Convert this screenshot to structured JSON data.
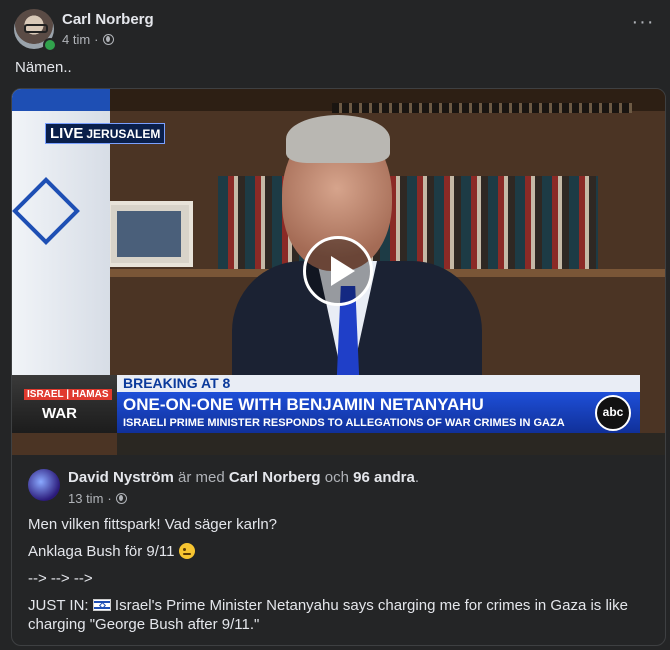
{
  "post": {
    "author": "Carl Norberg",
    "time": "4 tim",
    "separator": "·",
    "caption": "Nämen..",
    "more_icon": "more-horizontal-icon",
    "privacy_icon": "globe-icon"
  },
  "video": {
    "live_label": "LIVE",
    "live_city": "JERUSALEM",
    "chyron_sub": "ISRAEL | HAMAS",
    "chyron_war": "WAR",
    "breaking": "BREAKING AT 8",
    "headline": "ONE-ON-ONE WITH BENJAMIN NETANYAHU",
    "subheadline": "ISRAELI PRIME MINISTER RESPONDS TO ALLEGATIONS OF WAR CRIMES IN GAZA",
    "network": "abc"
  },
  "shared": {
    "author": "David Nyström",
    "with_text": "är med",
    "tagged": "Carl Norberg",
    "and_text": "och",
    "others": "96 andra",
    "period": ".",
    "time": "13 tim",
    "separator": "·",
    "line1": "Men vilken fittspark! Vad säger karln?",
    "line2": "Anklaga Bush för 9/11",
    "line3": "--> --> -->",
    "line4_prefix": "JUST IN:",
    "line4": "Israel's Prime Minister Netanyahu says charging me for crimes in Gaza is like charging \"George Bush after 9/11.\""
  },
  "colors": {
    "background": "#242526",
    "text_primary": "#e4e6eb",
    "text_secondary": "#b0b3b8",
    "online": "#31a24c"
  }
}
